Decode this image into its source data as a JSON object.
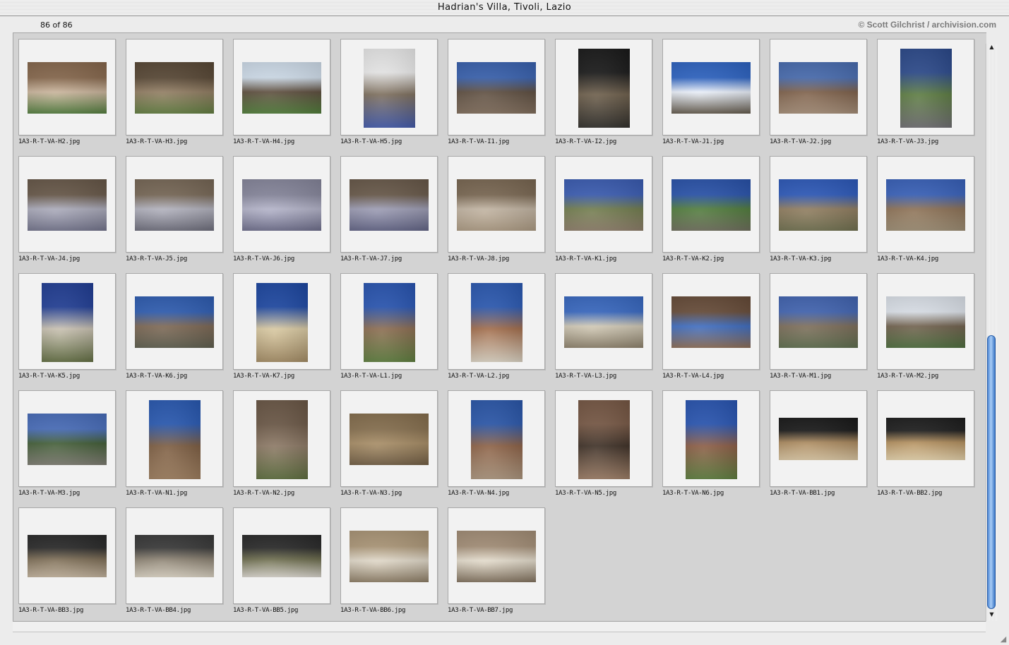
{
  "window": {
    "title": "Hadrian's Villa, Tivoli, Lazio",
    "count": "86 of 86",
    "credit": "© Scott Gilchrist / archivision.com"
  },
  "gallery": {
    "items": [
      {
        "caption": "1A3-R-T-VA-H2.jpg",
        "orientation": "land",
        "colors": [
          "#8a6a4e",
          "#c9b39a",
          "#4f7a3a"
        ]
      },
      {
        "caption": "1A3-R-T-VA-H3.jpg",
        "orientation": "land",
        "colors": [
          "#5a4936",
          "#8f7a5f",
          "#5e7a3c"
        ]
      },
      {
        "caption": "1A3-R-T-VA-H4.jpg",
        "orientation": "land",
        "colors": [
          "#d6e4f2",
          "#5a4a3a",
          "#4d7a36"
        ]
      },
      {
        "caption": "1A3-R-T-VA-H5.jpg",
        "orientation": "port",
        "colors": [
          "#f2f2f2",
          "#7b6c5a",
          "#3e56a8"
        ]
      },
      {
        "caption": "1A3-R-T-VA-I1.jpg",
        "orientation": "land",
        "colors": [
          "#3a64b4",
          "#5a4a3c",
          "#7d6a58"
        ]
      },
      {
        "caption": "1A3-R-T-VA-I2.jpg",
        "orientation": "port",
        "colors": [
          "#1a1a1a",
          "#6b5c48",
          "#2c2a26"
        ]
      },
      {
        "caption": "1A3-R-T-VA-J1.jpg",
        "orientation": "land",
        "colors": [
          "#2e66c8",
          "#eaf0fa",
          "#5f5648"
        ]
      },
      {
        "caption": "1A3-R-T-VA-J2.jpg",
        "orientation": "land",
        "colors": [
          "#4a6fb5",
          "#7b5d46",
          "#a28a74"
        ]
      },
      {
        "caption": "1A3-R-T-VA-J3.jpg",
        "orientation": "port",
        "colors": [
          "#2d4c90",
          "#5a7a3e",
          "#6b6a6e"
        ]
      },
      {
        "caption": "1A3-R-T-VA-J4.jpg",
        "orientation": "land",
        "colors": [
          "#6a5a4a",
          "#a9a9b9",
          "#6f7088"
        ]
      },
      {
        "caption": "1A3-R-T-VA-J5.jpg",
        "orientation": "land",
        "colors": [
          "#7a6a58",
          "#b0b0bc",
          "#6a6a78"
        ]
      },
      {
        "caption": "1A3-R-T-VA-J6.jpg",
        "orientation": "land",
        "colors": [
          "#8a8aa0",
          "#b2b2c8",
          "#6a6a88"
        ]
      },
      {
        "caption": "1A3-R-T-VA-J7.jpg",
        "orientation": "land",
        "colors": [
          "#6b5b4b",
          "#9a9ab2",
          "#5e6082"
        ]
      },
      {
        "caption": "1A3-R-T-VA-J8.jpg",
        "orientation": "land",
        "colors": [
          "#7d6a54",
          "#c0b2a0",
          "#a8967e"
        ]
      },
      {
        "caption": "1A3-R-T-VA-K1.jpg",
        "orientation": "land",
        "colors": [
          "#3c5fb8",
          "#6e7a4a",
          "#8a7a66"
        ]
      },
      {
        "caption": "1A3-R-T-VA-K2.jpg",
        "orientation": "land",
        "colors": [
          "#2a55b0",
          "#4d7a38",
          "#6a6a58"
        ]
      },
      {
        "caption": "1A3-R-T-VA-K3.jpg",
        "orientation": "land",
        "colors": [
          "#2e5cc0",
          "#8e7a5c",
          "#6b6b4a"
        ]
      },
      {
        "caption": "1A3-R-T-VA-K4.jpg",
        "orientation": "land",
        "colors": [
          "#3a64c0",
          "#8a6e52",
          "#9a8a70"
        ]
      },
      {
        "caption": "1A3-R-T-VA-K5.jpg",
        "orientation": "port",
        "colors": [
          "#22409a",
          "#c8c0b0",
          "#5e6a3e"
        ]
      },
      {
        "caption": "1A3-R-T-VA-K6.jpg",
        "orientation": "land",
        "colors": [
          "#3060b8",
          "#7a6450",
          "#5a5a4a"
        ]
      },
      {
        "caption": "1A3-R-T-VA-K7.jpg",
        "orientation": "port",
        "colors": [
          "#1e4aa8",
          "#d8c8a0",
          "#a08860"
        ]
      },
      {
        "caption": "1A3-R-T-VA-L1.jpg",
        "orientation": "port",
        "colors": [
          "#2a58b8",
          "#8a6a4e",
          "#5a7a3a"
        ]
      },
      {
        "caption": "1A3-R-T-VA-L2.jpg",
        "orientation": "port",
        "colors": [
          "#2c5cb8",
          "#a06a48",
          "#d8d0c0"
        ]
      },
      {
        "caption": "1A3-R-T-VA-L3.jpg",
        "orientation": "land",
        "colors": [
          "#3a6cc8",
          "#d0c8b4",
          "#8a7e68"
        ]
      },
      {
        "caption": "1A3-R-T-VA-L4.jpg",
        "orientation": "land",
        "colors": [
          "#6a4e3a",
          "#3a6ac0",
          "#8a6a52"
        ]
      },
      {
        "caption": "1A3-R-T-VA-M1.jpg",
        "orientation": "land",
        "colors": [
          "#4468b8",
          "#7a6a56",
          "#5a6a4a"
        ]
      },
      {
        "caption": "1A3-R-T-VA-M2.jpg",
        "orientation": "land",
        "colors": [
          "#e4eaf2",
          "#6e5e4a",
          "#4a6a3a"
        ]
      },
      {
        "caption": "1A3-R-T-VA-M3.jpg",
        "orientation": "land",
        "colors": [
          "#4a70c0",
          "#3e5a32",
          "#7a786e"
        ]
      },
      {
        "caption": "1A3-R-T-VA-N1.jpg",
        "orientation": "port",
        "colors": [
          "#2a5cb8",
          "#7a5a3e",
          "#9a7a5a"
        ]
      },
      {
        "caption": "1A3-R-T-VA-N2.jpg",
        "orientation": "port",
        "colors": [
          "#6e5a48",
          "#8a7662",
          "#5a6a3a"
        ]
      },
      {
        "caption": "1A3-R-T-VA-N3.jpg",
        "orientation": "land",
        "colors": [
          "#8a7250",
          "#a58a62",
          "#6e5a40"
        ]
      },
      {
        "caption": "1A3-R-T-VA-N4.jpg",
        "orientation": "port",
        "colors": [
          "#2c5ab0",
          "#8a5e42",
          "#a8927a"
        ]
      },
      {
        "caption": "1A3-R-T-VA-N5.jpg",
        "orientation": "port",
        "colors": [
          "#7a5a46",
          "#3a2c22",
          "#9a7a62"
        ]
      },
      {
        "caption": "1A3-R-T-VA-N6.jpg",
        "orientation": "port",
        "colors": [
          "#2a58b8",
          "#8a5a42",
          "#5a7a3a"
        ]
      },
      {
        "caption": "1A3-R-T-VA-BB1.jpg",
        "orientation": "model",
        "colors": [
          "#1a1a1a",
          "#a8865a",
          "#d8c4a0"
        ]
      },
      {
        "caption": "1A3-R-T-VA-BB2.jpg",
        "orientation": "model",
        "colors": [
          "#1e1e1e",
          "#b08c5a",
          "#e2cfa8"
        ]
      },
      {
        "caption": "1A3-R-T-VA-BB3.jpg",
        "orientation": "model",
        "colors": [
          "#2a2a2a",
          "#7a6a52",
          "#c0b09a"
        ]
      },
      {
        "caption": "1A3-R-T-VA-BB4.jpg",
        "orientation": "model",
        "colors": [
          "#3a3a3a",
          "#8a8070",
          "#d8d0c0"
        ]
      },
      {
        "caption": "1A3-R-T-VA-BB5.jpg",
        "orientation": "model",
        "colors": [
          "#2a2a2a",
          "#6a6a4a",
          "#d8d4cc"
        ]
      },
      {
        "caption": "1A3-R-T-VA-BB6.jpg",
        "orientation": "land",
        "colors": [
          "#b09a7a",
          "#e0d8c8",
          "#8a7a62"
        ]
      },
      {
        "caption": "1A3-R-T-VA-BB7.jpg",
        "orientation": "land",
        "colors": [
          "#a8927a",
          "#e4dccc",
          "#7e6e5a"
        ]
      }
    ]
  }
}
